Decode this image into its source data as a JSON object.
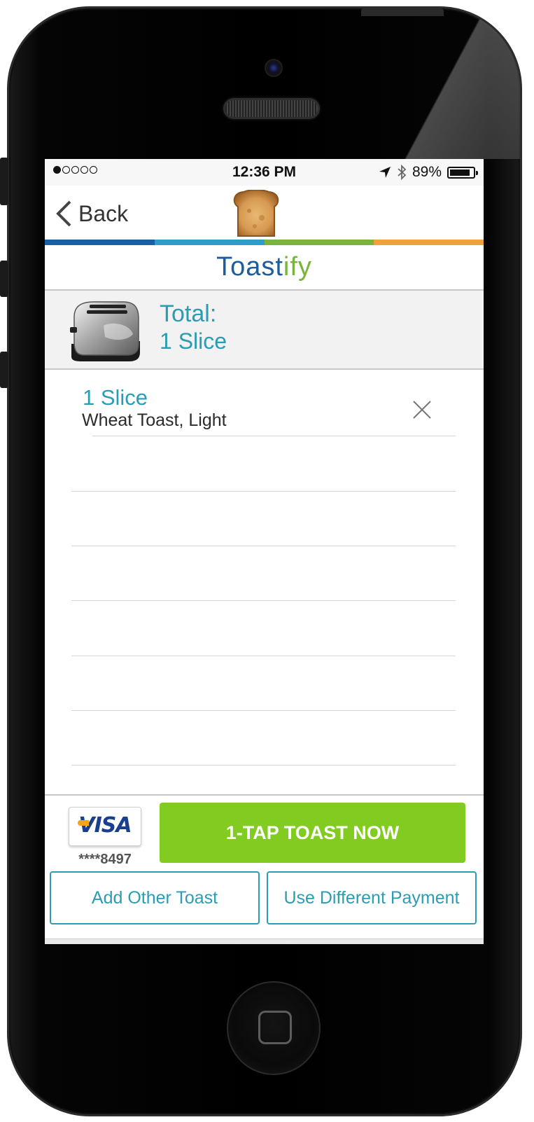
{
  "status_bar": {
    "signal_dots_filled": 1,
    "signal_dots_total": 5,
    "time": "12:36 PM",
    "battery": "89%",
    "battery_level": 0.89
  },
  "nav": {
    "back_label": "Back"
  },
  "brand": {
    "name_prefix": "Toast",
    "name_accent": "i",
    "name_suffix": "fy"
  },
  "stripe_colors": [
    "#1d5e9e",
    "#2d9ec4",
    "#7ab43c",
    "#f0a236"
  ],
  "total": {
    "label": "Total:",
    "value": "1 Slice"
  },
  "order_items": [
    {
      "title": "1 Slice",
      "description": "Wheat Toast, Light"
    }
  ],
  "payment": {
    "card_brand": "VISA",
    "card_number": "****8497"
  },
  "actions": {
    "one_tap": "1-TAP TOAST NOW",
    "add_other": "Add Other Toast",
    "different_payment": "Use Different Payment"
  },
  "colors": {
    "accent": "#2c9cb2",
    "primary_button": "#82cc22",
    "brand_blue": "#1b5d9d",
    "brand_green": "#7ab43c"
  }
}
